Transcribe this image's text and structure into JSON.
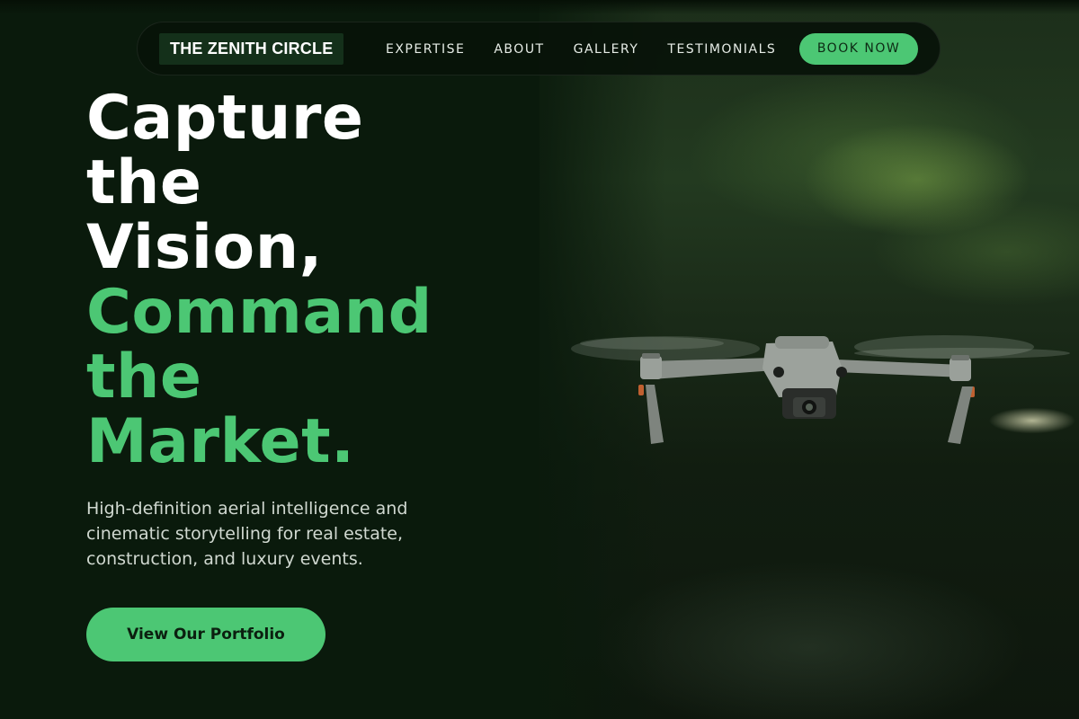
{
  "nav": {
    "brand": "THE ZENITH CIRCLE",
    "links": [
      "EXPERTISE",
      "ABOUT",
      "GALLERY",
      "TESTIMONIALS"
    ],
    "cta": "BOOK NOW"
  },
  "hero": {
    "headline_white": [
      "Capture",
      "the",
      "Vision,"
    ],
    "headline_green": [
      "Command",
      "the",
      "Market."
    ],
    "subtext": "High-definition aerial intelligence and cinematic storytelling for real estate, construction, and luxury events.",
    "cta": "View Our Portfolio",
    "image_icon": "drone-photo"
  },
  "colors": {
    "background": "#0a1a0c",
    "accent": "#4cc774",
    "text": "#ffffff"
  }
}
